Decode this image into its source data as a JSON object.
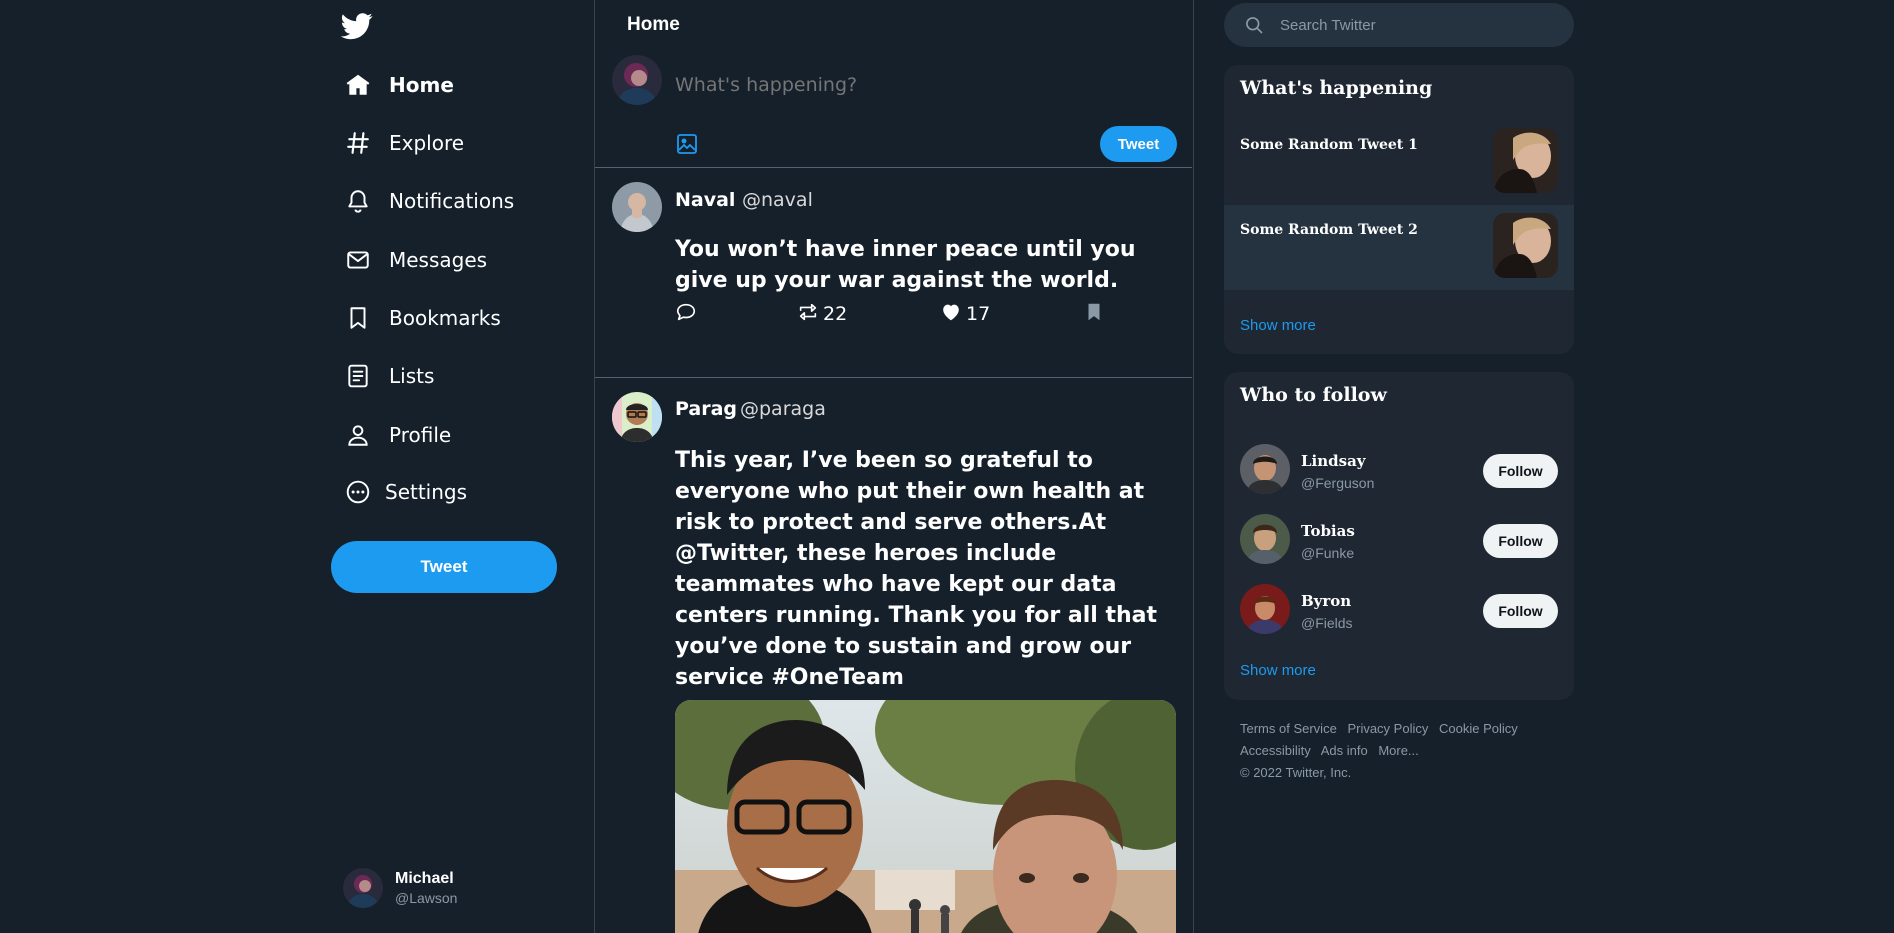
{
  "app": {
    "brand_color": "#1d9bf0",
    "background": "#15202b"
  },
  "sidebar": {
    "logo_icon": "twitter-bird-icon",
    "nav": [
      {
        "label": "Home",
        "icon": "home-icon",
        "active": true
      },
      {
        "label": "Explore",
        "icon": "hashtag-icon"
      },
      {
        "label": "Notifications",
        "icon": "bell-icon"
      },
      {
        "label": "Messages",
        "icon": "envelope-icon"
      },
      {
        "label": "Bookmarks",
        "icon": "bookmark-icon"
      },
      {
        "label": "Lists",
        "icon": "list-icon"
      },
      {
        "label": "Profile",
        "icon": "person-icon"
      },
      {
        "label": "Settings",
        "icon": "more-circle-icon"
      }
    ],
    "tweet_button": "Tweet",
    "account": {
      "name": "Michael",
      "handle": "@Lawson"
    }
  },
  "feed": {
    "title": "Home",
    "composer": {
      "placeholder": "What's happening?",
      "tweet_button": "Tweet"
    },
    "posts": [
      {
        "name": "Naval",
        "handle": "@naval",
        "text": "You won’t have inner peace until you give up your war against the world.",
        "retweets": "22",
        "likes": "17"
      },
      {
        "name": "Parag",
        "handle": "@paraga",
        "text": "This year, I’ve been so grateful to everyone who put their own health at risk to protect and serve others.At @Twitter, these heroes include teammates who have kept our data centers running. Thank you for all that you’ve done to sustain and grow our service #OneTeam"
      }
    ]
  },
  "right": {
    "search_placeholder": "Search Twitter",
    "happening": {
      "title": "What's happening",
      "items": [
        {
          "title": "Some Random Tweet 1"
        },
        {
          "title": "Some Random Tweet 2"
        }
      ],
      "show_more": "Show more"
    },
    "who_to_follow": {
      "title": "Who to follow",
      "items": [
        {
          "name": "Lindsay",
          "handle": "@Ferguson",
          "button": "Follow"
        },
        {
          "name": "Tobias",
          "handle": "@Funke",
          "button": "Follow"
        },
        {
          "name": "Byron",
          "handle": "@Fields",
          "button": "Follow"
        }
      ],
      "show_more": "Show more"
    },
    "footer": {
      "links": [
        "Terms of Service",
        "Privacy Policy",
        "Cookie Policy",
        "Accessibility",
        "Ads info",
        "More..."
      ],
      "copyright": "© 2022 Twitter, Inc."
    }
  }
}
